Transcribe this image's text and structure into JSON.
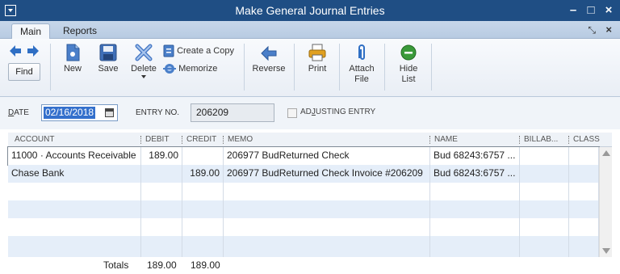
{
  "window": {
    "title": "Make General Journal Entries"
  },
  "tabs": [
    {
      "label": "Main"
    },
    {
      "label": "Reports"
    }
  ],
  "toolbar": {
    "find": "Find",
    "new": "New",
    "save": "Save",
    "delete": "Delete",
    "create_copy": "Create a Copy",
    "memorize": "Memorize",
    "reverse": "Reverse",
    "print": "Print",
    "attach_file_1": "Attach",
    "attach_file_2": "File",
    "hide_list_1": "Hide",
    "hide_list_2": "List"
  },
  "form": {
    "date_label_first": "D",
    "date_label_rest": "ATE",
    "date_value": "02/16/2018",
    "entry_no_label": "ENTRY NO.",
    "entry_no_value": "206209",
    "adjusting_label_1": "AD",
    "adjusting_label_2": "J",
    "adjusting_label_3": "USTING ENTRY",
    "adjusting_checked": false
  },
  "grid": {
    "columns": [
      "ACCOUNT",
      "DEBIT",
      "CREDIT",
      "MEMO",
      "NAME",
      "BILLAB...",
      "CLASS"
    ],
    "rows": [
      {
        "account": "11000 · Accounts Receivable",
        "debit": "189.00",
        "credit": "",
        "memo": "206977 BudReturned Check",
        "name": "Bud 68243:6757 ...",
        "billable": "",
        "class": ""
      },
      {
        "account": "Chase Bank",
        "debit": "",
        "credit": "189.00",
        "memo": "206977 BudReturned Check Invoice #206209",
        "name": "Bud 68243:6757 ...",
        "billable": "",
        "class": ""
      },
      {
        "account": "",
        "debit": "",
        "credit": "",
        "memo": "",
        "name": "",
        "billable": "",
        "class": ""
      },
      {
        "account": "",
        "debit": "",
        "credit": "",
        "memo": "",
        "name": "",
        "billable": "",
        "class": ""
      },
      {
        "account": "",
        "debit": "",
        "credit": "",
        "memo": "",
        "name": "",
        "billable": "",
        "class": ""
      },
      {
        "account": "",
        "debit": "",
        "credit": "",
        "memo": "",
        "name": "",
        "billable": "",
        "class": ""
      },
      {
        "account": "",
        "debit": "",
        "credit": "",
        "memo": "",
        "name": "",
        "billable": "",
        "class": ""
      }
    ],
    "totals_label": "Totals",
    "total_debit": "189.00",
    "total_credit": "189.00"
  },
  "colors": {
    "titlebar": "#1f4e84",
    "row_alt": "#e5eef9",
    "selected_date": "#3470cc",
    "accent_blue": "#2f6fc4",
    "hide_list_green": "#3a9a3a"
  }
}
